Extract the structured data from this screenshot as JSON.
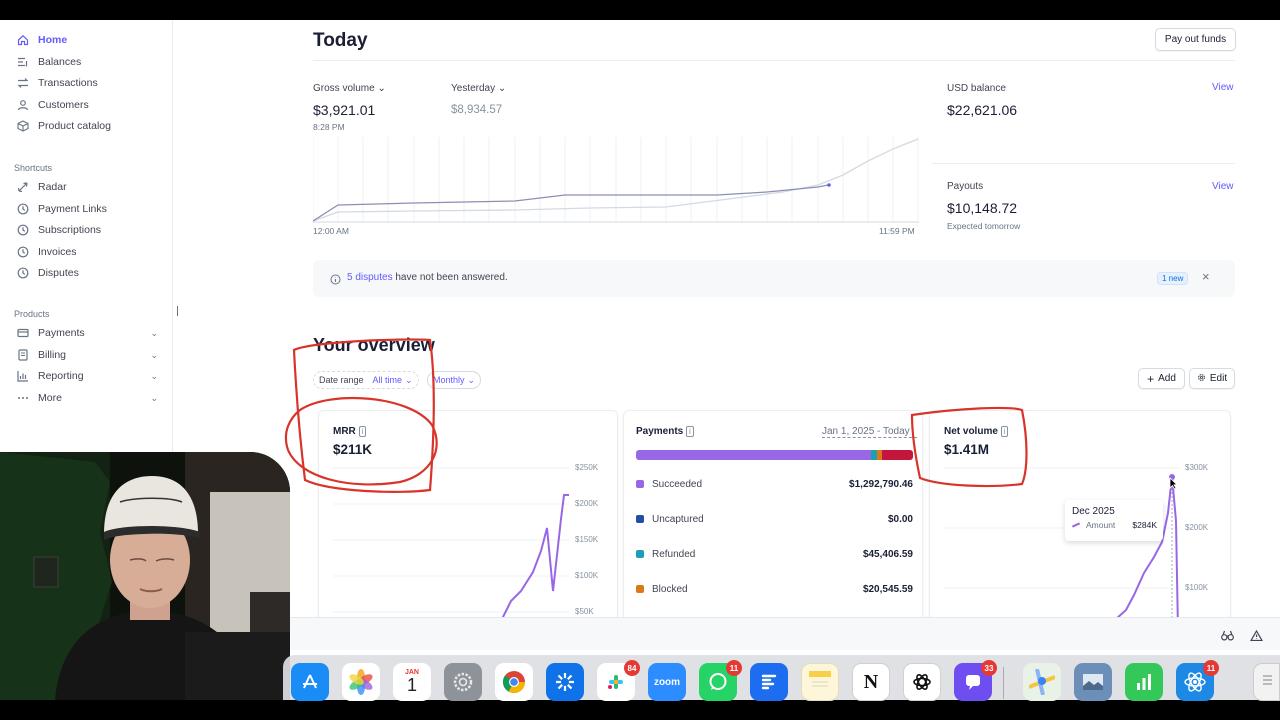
{
  "sidebar": {
    "items": [
      {
        "label": "Home",
        "icon": "home-icon",
        "active": true
      },
      {
        "label": "Balances",
        "icon": "balances-icon"
      },
      {
        "label": "Transactions",
        "icon": "transactions-icon"
      },
      {
        "label": "Customers",
        "icon": "customers-icon"
      },
      {
        "label": "Product catalog",
        "icon": "product-catalog-icon"
      }
    ],
    "shortcuts_label": "Shortcuts",
    "shortcuts": [
      {
        "label": "Radar",
        "icon": "radar-icon"
      },
      {
        "label": "Payment Links",
        "icon": "clock-icon"
      },
      {
        "label": "Subscriptions",
        "icon": "clock-icon"
      },
      {
        "label": "Invoices",
        "icon": "clock-icon"
      },
      {
        "label": "Disputes",
        "icon": "clock-icon"
      }
    ],
    "products_label": "Products",
    "products": [
      {
        "label": "Payments",
        "icon": "payments-icon"
      },
      {
        "label": "Billing",
        "icon": "billing-icon"
      },
      {
        "label": "Reporting",
        "icon": "reporting-icon"
      },
      {
        "label": "More",
        "icon": "more-icon"
      }
    ]
  },
  "today": {
    "title": "Today",
    "payout_button": "Pay out funds",
    "gross_volume_label": "Gross volume",
    "gross_volume_value": "$3,921.01",
    "gross_volume_time": "8:28 PM",
    "yesterday_label": "Yesterday",
    "yesterday_value": "$8,934.57",
    "axis_start": "12:00 AM",
    "axis_end": "11:59 PM",
    "usd_balance_label": "USD balance",
    "usd_balance_value": "$22,621.06",
    "payouts_label": "Payouts",
    "payouts_value": "$10,148.72",
    "payouts_note": "Expected tomorrow",
    "view_label": "View"
  },
  "banner": {
    "link_text": "5 disputes",
    "text": " have not been answered.",
    "badge": "1 new"
  },
  "overview": {
    "title": "Your overview",
    "date_range_label": "Date range",
    "date_range_value": "All time",
    "interval_value": "Monthly",
    "add_label": "Add",
    "edit_label": "Edit"
  },
  "mrr_card": {
    "title": "MRR",
    "value": "$211K",
    "ticks": [
      "$250K",
      "$200K",
      "$150K",
      "$100K",
      "$50K"
    ]
  },
  "payments_card": {
    "title": "Payments",
    "date": "Jan 1, 2025 - Today",
    "rows": [
      {
        "label": "Succeeded",
        "value": "$1,292,790.46",
        "color": "#9966e6"
      },
      {
        "label": "Uncaptured",
        "value": "$0.00",
        "color": "#1d4fa8"
      },
      {
        "label": "Refunded",
        "value": "$45,406.59",
        "color": "#1aa0b5"
      },
      {
        "label": "Blocked",
        "value": "$20,545.59",
        "color": "#d97a17"
      }
    ]
  },
  "net_volume_card": {
    "title": "Net volume",
    "value": "$1.41M",
    "ticks": [
      "$300K",
      "$200K",
      "$100K"
    ],
    "tooltip_month": "Dec 2025",
    "tooltip_label": "Amount",
    "tooltip_value": "$284K"
  },
  "dock": {
    "calendar_month": "JAN",
    "calendar_day": "1",
    "zoom_label": "zoom",
    "badges": {
      "slack": "84",
      "whatsapp": "11",
      "app33": "33",
      "app11": "11"
    }
  },
  "colors": {
    "accent": "#635bff",
    "chart_line": "#9966e6",
    "annotation": "#d8342a"
  }
}
